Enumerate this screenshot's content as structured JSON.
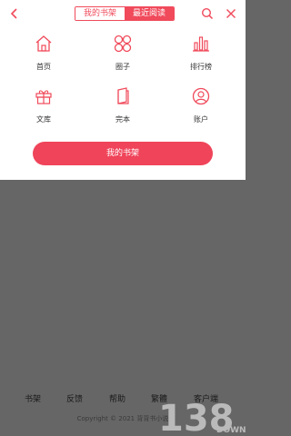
{
  "header": {
    "tabs": [
      {
        "label": "我的书架",
        "active": true
      },
      {
        "label": "最近阅读",
        "active": false
      }
    ],
    "icons": {
      "back": "chevron-left-icon",
      "search": "search-icon",
      "close": "close-icon"
    }
  },
  "grid": {
    "items": [
      {
        "label": "首页",
        "icon": "home-icon"
      },
      {
        "label": "圈子",
        "icon": "four-circles-icon"
      },
      {
        "label": "排行榜",
        "icon": "bar-chart-icon"
      },
      {
        "label": "文库",
        "icon": "gift-icon"
      },
      {
        "label": "完本",
        "icon": "book-icon"
      },
      {
        "label": "账户",
        "icon": "user-circle-icon"
      }
    ]
  },
  "cta": {
    "label": "我的书架"
  },
  "footer": {
    "links": [
      "书架",
      "反馈",
      "帮助",
      "繁體",
      "客户端"
    ],
    "copyright": "Copyright © 2021 背背书小说"
  },
  "colors": {
    "accent": "#f04a5b",
    "overlay": "#666666",
    "panel": "#ffffff"
  }
}
